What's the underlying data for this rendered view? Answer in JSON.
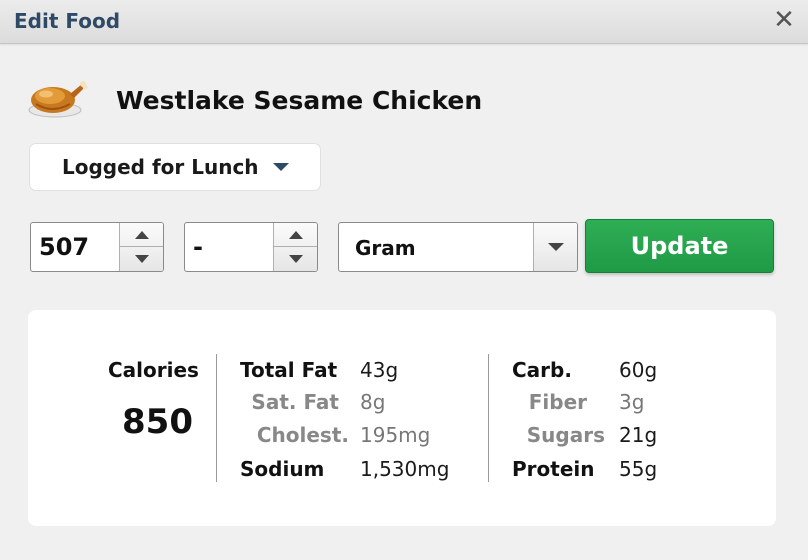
{
  "dialog": {
    "title": "Edit Food",
    "close_glyph": "✕"
  },
  "food": {
    "name": "Westlake Sesame Chicken",
    "icon": "roast-chicken-icon"
  },
  "meal": {
    "label": "Logged for Lunch"
  },
  "quantity": {
    "amount": "507",
    "fraction": "-"
  },
  "unit": {
    "selected": "Gram"
  },
  "update_label": "Update",
  "colors": {
    "accent_green": "#22a24b",
    "title_blue": "#2e4a66"
  },
  "nutrition": {
    "calories_label": "Calories",
    "calories_value": "850",
    "total_fat_label": "Total Fat",
    "total_fat_value": "43g",
    "sat_fat_label": "Sat. Fat",
    "sat_fat_value": "8g",
    "cholest_label": "Cholest.",
    "cholest_value": "195mg",
    "sodium_label": "Sodium",
    "sodium_value": "1,530mg",
    "carb_label": "Carb.",
    "carb_value": "60g",
    "fiber_label": "Fiber",
    "fiber_value": "3g",
    "sugars_label": "Sugars",
    "sugars_value": "21g",
    "protein_label": "Protein",
    "protein_value": "55g"
  }
}
